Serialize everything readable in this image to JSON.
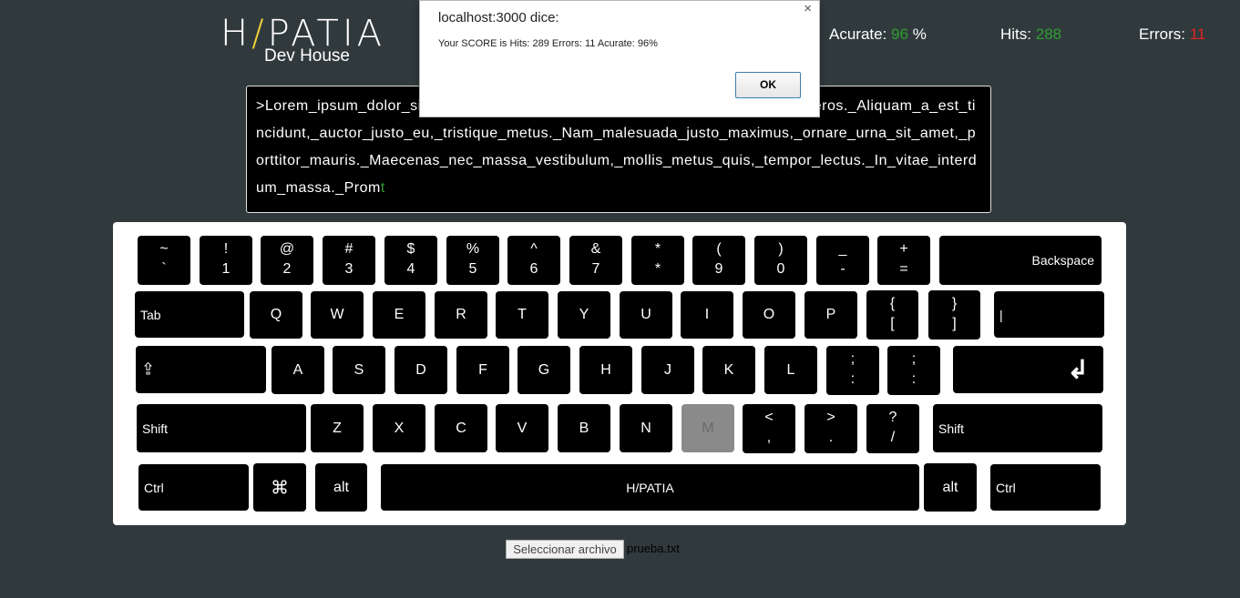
{
  "logo": {
    "left": "H",
    "slash": "/",
    "right": "PATIA",
    "subtitle": "Dev House"
  },
  "stats": {
    "accurate_label": "Acurate:",
    "accurate_value": "96",
    "accurate_unit": "%",
    "hits_label": "Hits:",
    "hits_value": "288",
    "errors_label": "Errors:",
    "errors_value": "11"
  },
  "typing": {
    "text": ">Lorem_ipsum_dolor_sit_amet,_consectetur_adipiscing_elit._Nulla_aliquet_nisl_eros._Aliquam_a_est_tincidunt,_auctor_justo_eu,_tristique_metus._Nam_malesuada_justo_maximus,_ornare_urna_sit_amet,_porttitor_mauris._Maecenas_nec_massa_vestibulum,_mollis_metus_quis,_tempor_lectus._In_vitae_interdum_massa._Prom",
    "current_char": "t"
  },
  "keyboard": {
    "row1": [
      {
        "top": "~",
        "bot": "`"
      },
      {
        "top": "!",
        "bot": "1"
      },
      {
        "top": "@",
        "bot": "2"
      },
      {
        "top": "#",
        "bot": "3"
      },
      {
        "top": "$",
        "bot": "4"
      },
      {
        "top": "%",
        "bot": "5"
      },
      {
        "top": "^",
        "bot": "6"
      },
      {
        "top": "&",
        "bot": "7"
      },
      {
        "top": "*",
        "bot": "*"
      },
      {
        "top": "(",
        "bot": "9"
      },
      {
        "top": ")",
        "bot": "0"
      },
      {
        "top": "_",
        "bot": "-"
      },
      {
        "top": "+",
        "bot": "="
      }
    ],
    "backspace": "Backspace",
    "tab": "Tab",
    "row2": [
      "Q",
      "W",
      "E",
      "R",
      "T",
      "Y",
      "U",
      "I",
      "O",
      "P"
    ],
    "row2_brackets": [
      {
        "top": "{",
        "bot": "["
      },
      {
        "top": "}",
        "bot": "]"
      }
    ],
    "pipe": "|",
    "caps": "⇪",
    "row3": [
      "A",
      "S",
      "D",
      "F",
      "G",
      "H",
      "J",
      "K",
      "L"
    ],
    "row3_punct": [
      {
        "top": ";",
        "bot": ":"
      },
      {
        "top": ";",
        "bot": ":"
      }
    ],
    "enter": "↲",
    "shift_left": "Shift",
    "row4": [
      "Z",
      "X",
      "C",
      "V",
      "B",
      "N",
      "M"
    ],
    "row4_punct": [
      {
        "top": "<",
        "bot": ","
      },
      {
        "top": ">",
        "bot": "."
      },
      {
        "top": "?",
        "bot": "/"
      }
    ],
    "shift_right": "Shift",
    "ctrl_left": "Ctrl",
    "cmd": "⌘",
    "alt_left": "alt",
    "space": "H/PATIA",
    "alt_right": "alt",
    "ctrl_right": "Ctrl",
    "pressed_key": "M"
  },
  "dialog": {
    "title": "localhost:3000 dice:",
    "message": "Your SCORE is Hits: 289 Errors: 11 Acurate: 96%",
    "ok_label": "OK",
    "close_label": "×"
  },
  "file": {
    "button_label": "Seleccionar archivo",
    "file_name": "prueba.txt"
  },
  "colors": {
    "background": "#303a3d",
    "good": "#2e9e2e",
    "bad": "#e0241e",
    "logo_accent": "#f2d03b"
  }
}
